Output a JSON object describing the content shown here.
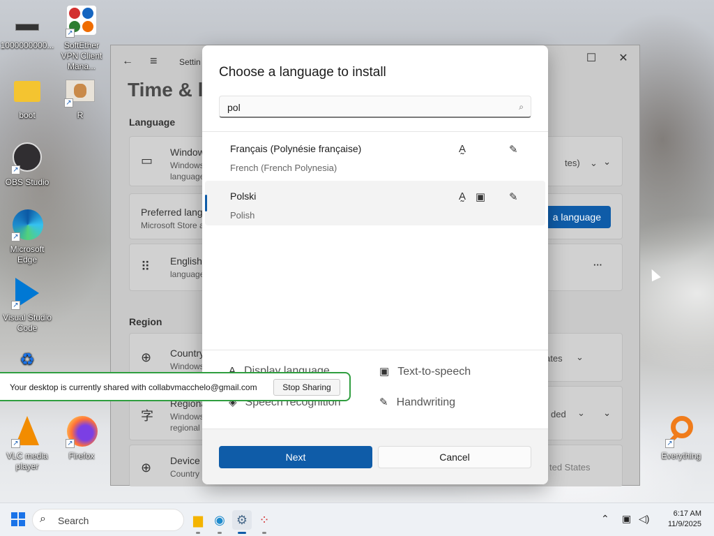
{
  "desktop": {
    "icons": [
      {
        "label": "1000000000..."
      },
      {
        "label": "SoftEther VPN Client Mana..."
      },
      {
        "label": "boot"
      },
      {
        "label": "R"
      },
      {
        "label": "OBS Studio"
      },
      {
        "label": "Microsoft Edge"
      },
      {
        "label": "Visual Studio Code"
      },
      {
        "label": "VLC media player"
      },
      {
        "label": "Firefox"
      },
      {
        "label": "Everything"
      }
    ]
  },
  "settings": {
    "app_title": "Settin",
    "page_title": "Time & la",
    "language_section": "Language",
    "region_section": "Region",
    "windows_display_language": {
      "title": "Window",
      "sub1": "Windows",
      "sub2": "language",
      "value": "tes)"
    },
    "preferred_languages": {
      "title": "Preferred lang",
      "sub": "Microsoft Store a",
      "button": "a language"
    },
    "english": {
      "title": "English",
      "sub": "language"
    },
    "country": {
      "title": "Country",
      "sub": "Windows",
      "value": "ates"
    },
    "regional_format": {
      "title": "Regiona",
      "sub1": "Windows",
      "sub2": "regional",
      "value": "ded"
    },
    "device": {
      "title": "Device s",
      "sub": "Country",
      "value": "ted States"
    }
  },
  "dialog": {
    "title": "Choose a language to install",
    "search_value": "pol",
    "results": [
      {
        "name": "Français (Polynésie française)",
        "sub": "French (French Polynesia)",
        "selected": false
      },
      {
        "name": "Polski",
        "sub": "Polish",
        "selected": true
      }
    ],
    "legend": {
      "display_language": "Display language",
      "speech_recognition": "Speech recognition",
      "text_to_speech": "Text-to-speech",
      "handwriting": "Handwriting"
    },
    "next_label": "Next",
    "cancel_label": "Cancel"
  },
  "share_bar": {
    "message": "Your desktop is currently shared with collabvmacchelo@gmail.com",
    "stop_label": "Stop Sharing"
  },
  "taskbar": {
    "search_placeholder": "Search",
    "time": "6:17 AM",
    "date": "11/9/2025"
  },
  "colors": {
    "accent": "#0f5ca8",
    "share_border": "#2f9e3f"
  }
}
